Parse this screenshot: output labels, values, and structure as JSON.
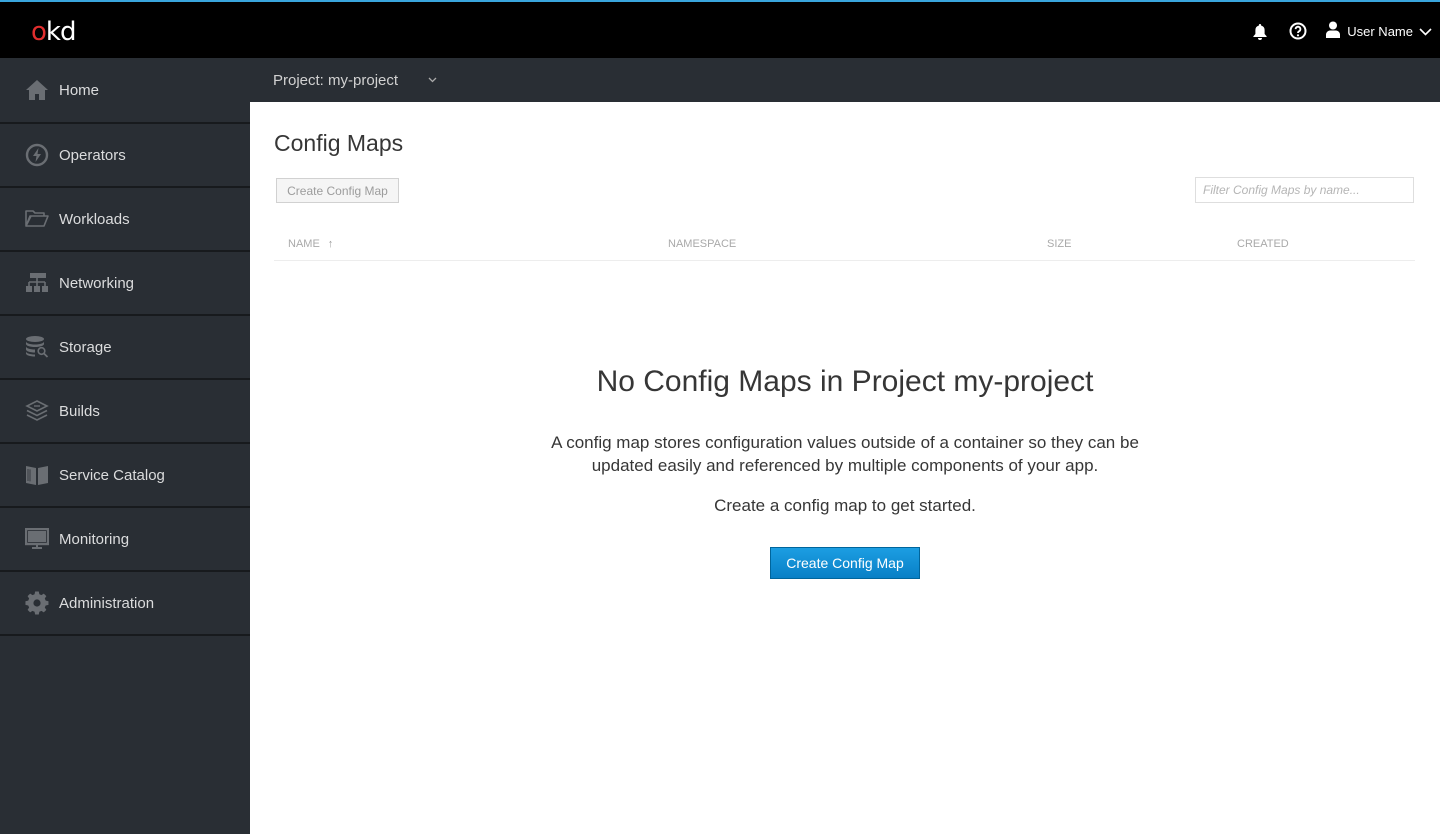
{
  "masthead": {
    "logo_o": "o",
    "logo_kd": "kd",
    "user_name": "User Name",
    "icons": [
      "bell-icon",
      "help-icon",
      "user-icon",
      "chevron-down-icon"
    ]
  },
  "sidebar": {
    "items": [
      {
        "label": "Home",
        "icon": "home-icon"
      },
      {
        "label": "Operators",
        "icon": "bolt-icon"
      },
      {
        "label": "Workloads",
        "icon": "folder-open-icon"
      },
      {
        "label": "Networking",
        "icon": "network-icon"
      },
      {
        "label": "Storage",
        "icon": "database-search-icon"
      },
      {
        "label": "Builds",
        "icon": "layers-icon"
      },
      {
        "label": "Service Catalog",
        "icon": "book-icon"
      },
      {
        "label": "Monitoring",
        "icon": "monitor-icon"
      },
      {
        "label": "Administration",
        "icon": "gear-icon"
      }
    ]
  },
  "project_bar": {
    "label": "Project: my-project",
    "chevron": "⌄"
  },
  "main": {
    "title": "Config Maps",
    "create_button": "Create Config Map",
    "filter_placeholder": "Filter Config Maps by name...",
    "columns": [
      {
        "label": "Name",
        "sorted": "ascending",
        "sort_glyph": "↑"
      },
      {
        "label": "Namespace"
      },
      {
        "label": "Size"
      },
      {
        "label": "Created"
      }
    ],
    "empty_state": {
      "title": "No Config Maps in Project my-project",
      "description": "A config map stores configuration values outside of a container so they can be updated easily and referenced by multiple components of your app.",
      "cta_text": "Create a config map to get started.",
      "button": "Create Config Map"
    }
  },
  "colors": {
    "accent_top": "#39a5dc",
    "logo_red": "#e12e2e",
    "sidebar_bg": "#292e34",
    "primary_button": "#0088ce"
  }
}
